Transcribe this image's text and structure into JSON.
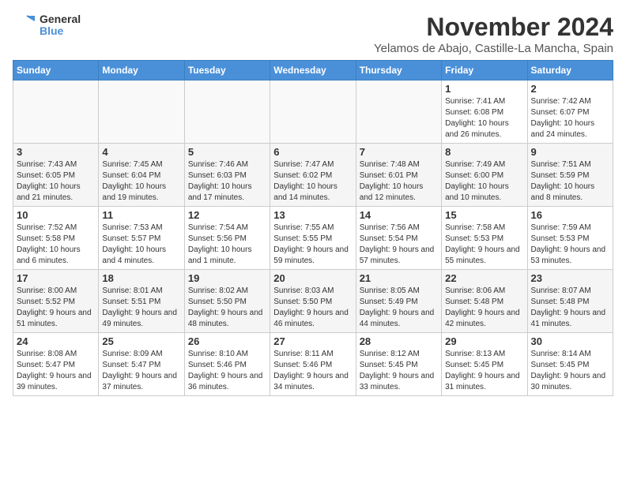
{
  "logo": {
    "general": "General",
    "blue": "Blue"
  },
  "header": {
    "month": "November 2024",
    "location": "Yelamos de Abajo, Castille-La Mancha, Spain"
  },
  "weekdays": [
    "Sunday",
    "Monday",
    "Tuesday",
    "Wednesday",
    "Thursday",
    "Friday",
    "Saturday"
  ],
  "weeks": [
    [
      {
        "day": "",
        "info": ""
      },
      {
        "day": "",
        "info": ""
      },
      {
        "day": "",
        "info": ""
      },
      {
        "day": "",
        "info": ""
      },
      {
        "day": "",
        "info": ""
      },
      {
        "day": "1",
        "info": "Sunrise: 7:41 AM\nSunset: 6:08 PM\nDaylight: 10 hours and 26 minutes."
      },
      {
        "day": "2",
        "info": "Sunrise: 7:42 AM\nSunset: 6:07 PM\nDaylight: 10 hours and 24 minutes."
      }
    ],
    [
      {
        "day": "3",
        "info": "Sunrise: 7:43 AM\nSunset: 6:05 PM\nDaylight: 10 hours and 21 minutes."
      },
      {
        "day": "4",
        "info": "Sunrise: 7:45 AM\nSunset: 6:04 PM\nDaylight: 10 hours and 19 minutes."
      },
      {
        "day": "5",
        "info": "Sunrise: 7:46 AM\nSunset: 6:03 PM\nDaylight: 10 hours and 17 minutes."
      },
      {
        "day": "6",
        "info": "Sunrise: 7:47 AM\nSunset: 6:02 PM\nDaylight: 10 hours and 14 minutes."
      },
      {
        "day": "7",
        "info": "Sunrise: 7:48 AM\nSunset: 6:01 PM\nDaylight: 10 hours and 12 minutes."
      },
      {
        "day": "8",
        "info": "Sunrise: 7:49 AM\nSunset: 6:00 PM\nDaylight: 10 hours and 10 minutes."
      },
      {
        "day": "9",
        "info": "Sunrise: 7:51 AM\nSunset: 5:59 PM\nDaylight: 10 hours and 8 minutes."
      }
    ],
    [
      {
        "day": "10",
        "info": "Sunrise: 7:52 AM\nSunset: 5:58 PM\nDaylight: 10 hours and 6 minutes."
      },
      {
        "day": "11",
        "info": "Sunrise: 7:53 AM\nSunset: 5:57 PM\nDaylight: 10 hours and 4 minutes."
      },
      {
        "day": "12",
        "info": "Sunrise: 7:54 AM\nSunset: 5:56 PM\nDaylight: 10 hours and 1 minute."
      },
      {
        "day": "13",
        "info": "Sunrise: 7:55 AM\nSunset: 5:55 PM\nDaylight: 9 hours and 59 minutes."
      },
      {
        "day": "14",
        "info": "Sunrise: 7:56 AM\nSunset: 5:54 PM\nDaylight: 9 hours and 57 minutes."
      },
      {
        "day": "15",
        "info": "Sunrise: 7:58 AM\nSunset: 5:53 PM\nDaylight: 9 hours and 55 minutes."
      },
      {
        "day": "16",
        "info": "Sunrise: 7:59 AM\nSunset: 5:53 PM\nDaylight: 9 hours and 53 minutes."
      }
    ],
    [
      {
        "day": "17",
        "info": "Sunrise: 8:00 AM\nSunset: 5:52 PM\nDaylight: 9 hours and 51 minutes."
      },
      {
        "day": "18",
        "info": "Sunrise: 8:01 AM\nSunset: 5:51 PM\nDaylight: 9 hours and 49 minutes."
      },
      {
        "day": "19",
        "info": "Sunrise: 8:02 AM\nSunset: 5:50 PM\nDaylight: 9 hours and 48 minutes."
      },
      {
        "day": "20",
        "info": "Sunrise: 8:03 AM\nSunset: 5:50 PM\nDaylight: 9 hours and 46 minutes."
      },
      {
        "day": "21",
        "info": "Sunrise: 8:05 AM\nSunset: 5:49 PM\nDaylight: 9 hours and 44 minutes."
      },
      {
        "day": "22",
        "info": "Sunrise: 8:06 AM\nSunset: 5:48 PM\nDaylight: 9 hours and 42 minutes."
      },
      {
        "day": "23",
        "info": "Sunrise: 8:07 AM\nSunset: 5:48 PM\nDaylight: 9 hours and 41 minutes."
      }
    ],
    [
      {
        "day": "24",
        "info": "Sunrise: 8:08 AM\nSunset: 5:47 PM\nDaylight: 9 hours and 39 minutes."
      },
      {
        "day": "25",
        "info": "Sunrise: 8:09 AM\nSunset: 5:47 PM\nDaylight: 9 hours and 37 minutes."
      },
      {
        "day": "26",
        "info": "Sunrise: 8:10 AM\nSunset: 5:46 PM\nDaylight: 9 hours and 36 minutes."
      },
      {
        "day": "27",
        "info": "Sunrise: 8:11 AM\nSunset: 5:46 PM\nDaylight: 9 hours and 34 minutes."
      },
      {
        "day": "28",
        "info": "Sunrise: 8:12 AM\nSunset: 5:45 PM\nDaylight: 9 hours and 33 minutes."
      },
      {
        "day": "29",
        "info": "Sunrise: 8:13 AM\nSunset: 5:45 PM\nDaylight: 9 hours and 31 minutes."
      },
      {
        "day": "30",
        "info": "Sunrise: 8:14 AM\nSunset: 5:45 PM\nDaylight: 9 hours and 30 minutes."
      }
    ]
  ]
}
